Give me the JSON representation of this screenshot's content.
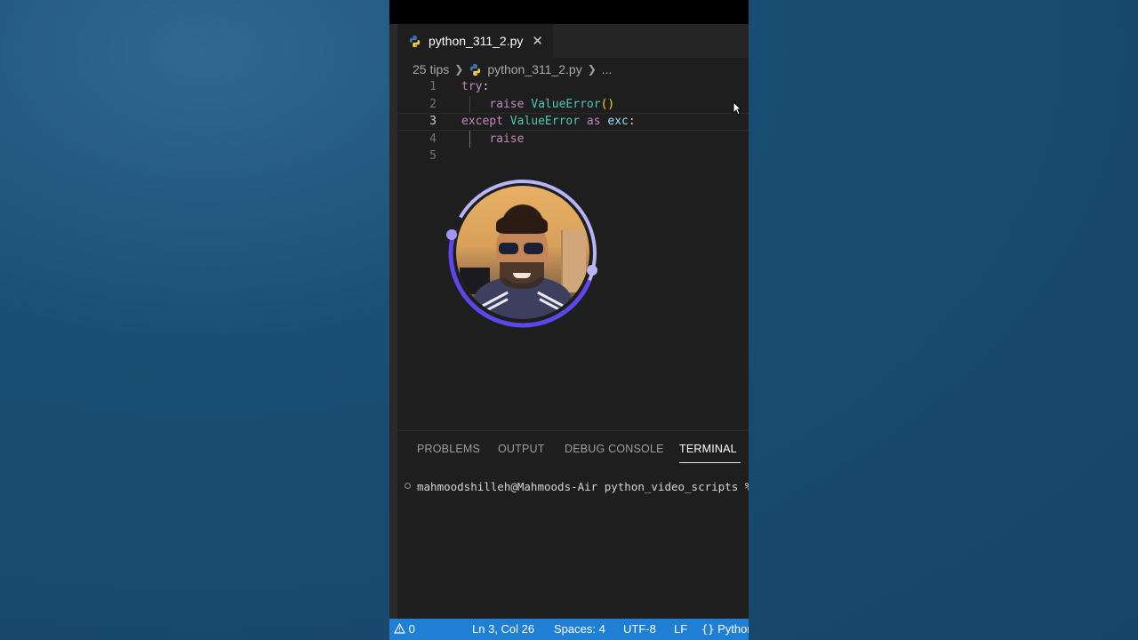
{
  "tab": {
    "label": "python_311_2.py",
    "icon": "python-icon",
    "close": "✕"
  },
  "breadcrumb": {
    "folder": "25 tips",
    "file": "python_311_2.py",
    "more": "..."
  },
  "code": {
    "lines": [
      {
        "n": "1",
        "tokens": [
          "try",
          ":"
        ]
      },
      {
        "n": "2",
        "tokens": [
          "raise",
          "ValueError",
          "()"
        ]
      },
      {
        "n": "3",
        "tokens": [
          "except",
          "ValueError",
          "as",
          "exc",
          ":"
        ]
      },
      {
        "n": "4",
        "tokens": [
          "raise"
        ]
      },
      {
        "n": "5",
        "tokens": []
      }
    ]
  },
  "panel": {
    "tabs": [
      "PROBLEMS",
      "OUTPUT",
      "DEBUG CONSOLE",
      "TERMINAL"
    ],
    "active": "TERMINAL"
  },
  "terminal": {
    "prompt": "mahmoodshilleh@Mahmoods-Air python_video_scripts %"
  },
  "status": {
    "warnings": "0",
    "position": "Ln 3, Col 26",
    "spaces": "Spaces: 4",
    "encoding": "UTF-8",
    "eol": "LF",
    "language": "Python"
  },
  "colors": {
    "background": "#164469",
    "editor": "#1e1e1e",
    "statusbar": "#1f7fd4",
    "keyword": "#c586c0",
    "class": "#4ec9b0",
    "variable": "#9cdcfe",
    "ring": "#6b5bf0"
  }
}
